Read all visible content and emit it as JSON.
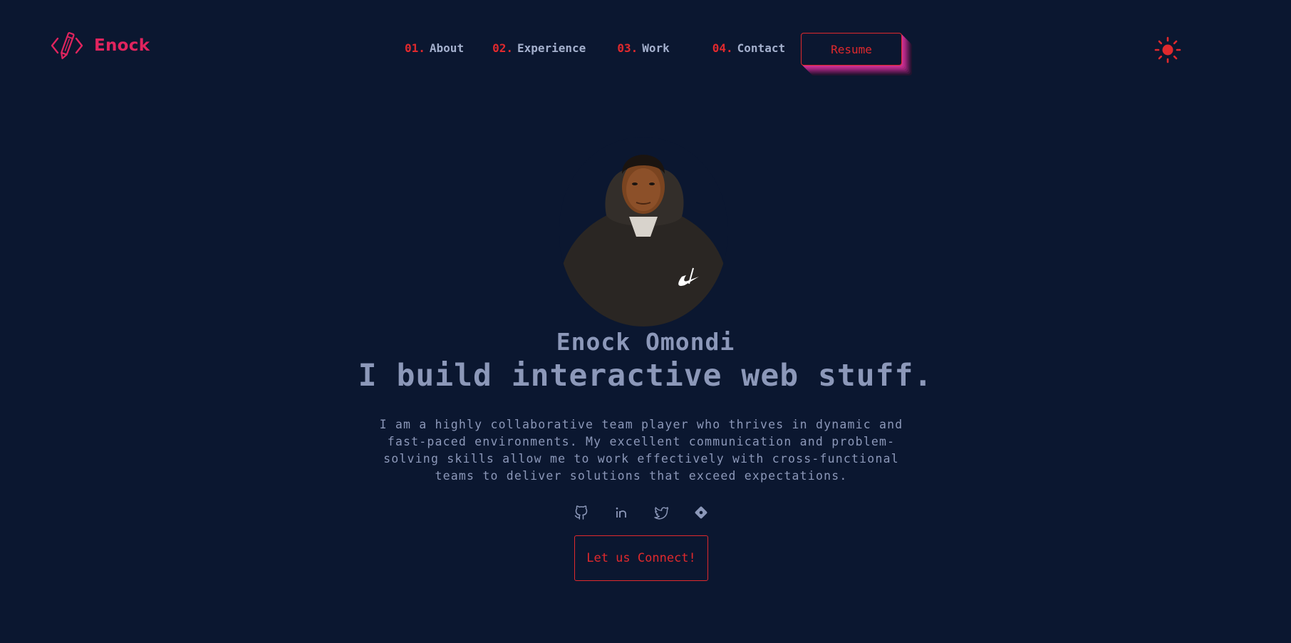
{
  "brand": {
    "name": "Enock",
    "logo_icon": "code-pencil-icon"
  },
  "nav": {
    "items": [
      {
        "num": "01.",
        "label": "About"
      },
      {
        "num": "02.",
        "label": "Experience"
      },
      {
        "num": "03.",
        "label": "Work"
      },
      {
        "num": "04.",
        "label": "Contact"
      }
    ],
    "resume_label": "Resume",
    "theme_icon": "sun-icon"
  },
  "hero": {
    "avatar_alt": "Enock Omondi",
    "name": "Enock Omondi",
    "headline": "I build interactive web stuff.",
    "bio": "I am a highly collaborative team player who thrives in dynamic and fast-paced environments. My excellent communication and problem-solving skills allow me to work effectively with cross-functional teams to deliver solutions that exceed expectations.",
    "socials": [
      "github-icon",
      "linkedin-icon",
      "twitter-icon",
      "git-icon"
    ],
    "cta_label": "Let us Connect!"
  },
  "colors": {
    "background": "#0b1730",
    "accent": "#e0292d",
    "brand": "#e0245e",
    "text": "#8c98b9",
    "shadow": "#c92f8f"
  }
}
